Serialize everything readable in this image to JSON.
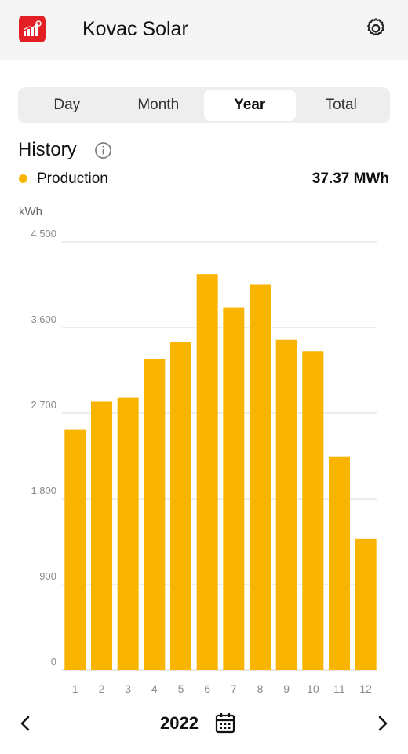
{
  "header": {
    "app_title": "Kovac Solar",
    "logo_icon": "solar-logo-icon",
    "settings_icon": "gear-icon"
  },
  "tabs": [
    {
      "label": "Day",
      "active": false
    },
    {
      "label": "Month",
      "active": false
    },
    {
      "label": "Year",
      "active": true
    },
    {
      "label": "Total",
      "active": false
    }
  ],
  "history": {
    "title": "History",
    "info_icon": "info-icon",
    "legend_label": "Production",
    "legend_total": "37.37 MWh",
    "unit": "kWh"
  },
  "footer": {
    "year": "2022",
    "prev_icon": "chevron-left-icon",
    "next_icon": "chevron-right-icon",
    "calendar_icon": "calendar-icon"
  },
  "colors": {
    "bar": "#f9b400",
    "logo": "#e31e24",
    "grid": "#d9d9d9",
    "axis_text": "#8a8a8a"
  },
  "chart_data": {
    "type": "bar",
    "categories": [
      "1",
      "2",
      "3",
      "4",
      "5",
      "6",
      "7",
      "8",
      "9",
      "10",
      "11",
      "12"
    ],
    "series": [
      {
        "name": "Production",
        "values": [
          2530,
          2820,
          2860,
          3270,
          3450,
          4160,
          3810,
          4050,
          3470,
          3350,
          2240,
          1380
        ]
      }
    ],
    "ylabel": "kWh",
    "ylim": [
      0,
      4500
    ],
    "yticks": [
      "0",
      "900",
      "1,800",
      "2,700",
      "3,600",
      "4,500"
    ],
    "ytick_values": [
      0,
      900,
      1800,
      2700,
      3600,
      4500
    ],
    "grid": true
  }
}
